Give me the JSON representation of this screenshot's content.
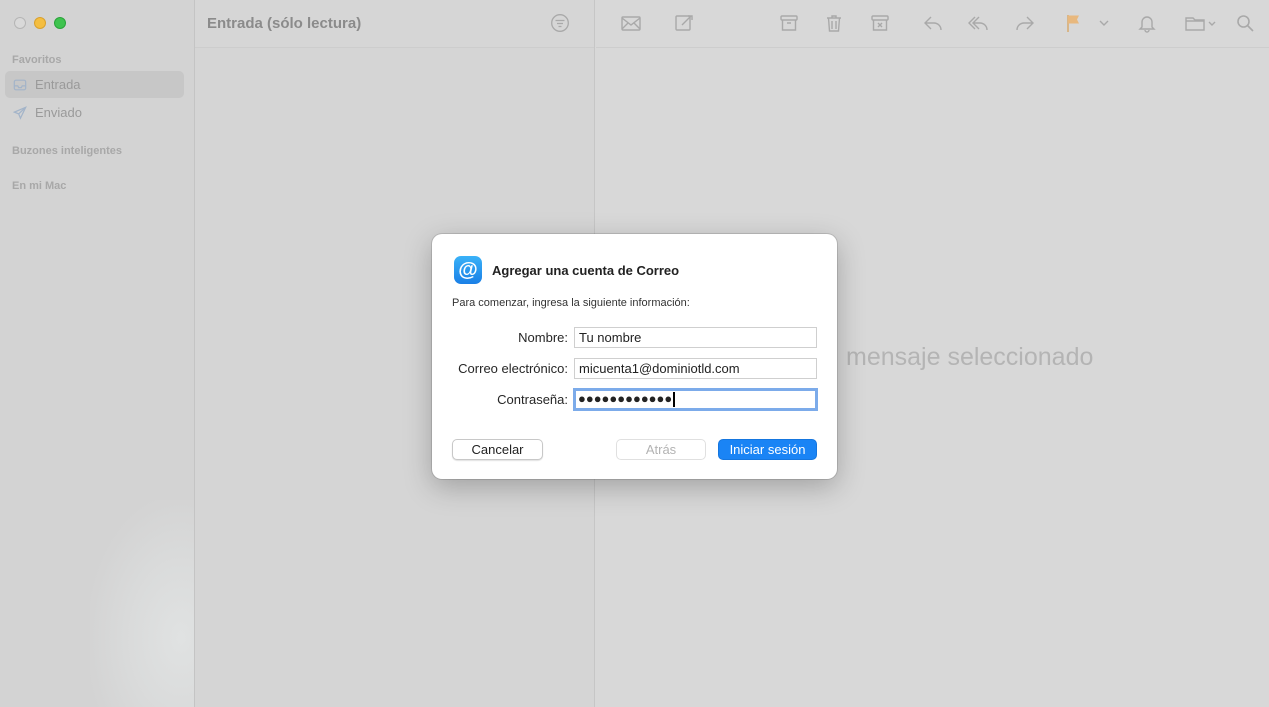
{
  "window": {
    "traffic_lights": [
      "close",
      "minimize",
      "maximize"
    ]
  },
  "sidebar": {
    "sections": {
      "favorites": "Favoritos",
      "smart": "Buzones inteligentes",
      "mac": "En mi Mac"
    },
    "items": [
      {
        "label": "Entrada",
        "icon": "inbox-icon",
        "active": true
      },
      {
        "label": "Enviado",
        "icon": "paper-plane-icon",
        "active": false
      }
    ]
  },
  "list": {
    "title": "Entrada (sólo lectura)",
    "filter_icon": "filter-icon"
  },
  "toolbar": {
    "icons": [
      "envelope-icon",
      "compose-icon",
      "archive-icon",
      "trash-icon",
      "junk-icon",
      "reply-icon",
      "reply-all-icon",
      "forward-icon",
      "flag-icon",
      "chevron-down-icon",
      "bell-icon",
      "folder-icon",
      "search-icon"
    ]
  },
  "reader": {
    "empty_text": "mensaje seleccionado"
  },
  "dialog": {
    "title": "Agregar una cuenta de Correo",
    "subtitle": "Para comenzar, ingresa la siguiente información:",
    "fields": {
      "name_label": "Nombre:",
      "name_value": "Tu nombre",
      "email_label": "Correo electrónico:",
      "email_value": "micuenta1@dominiotld.com",
      "password_label": "Contraseña:",
      "password_value": "●●●●●●●●●●●●"
    },
    "buttons": {
      "cancel": "Cancelar",
      "back": "Atrás",
      "login": "Iniciar sesión"
    },
    "icon_glyph": "@"
  },
  "colors": {
    "accent": "#1a84f5",
    "focus_ring": "#7cabea",
    "flag": "#e8b87e"
  }
}
